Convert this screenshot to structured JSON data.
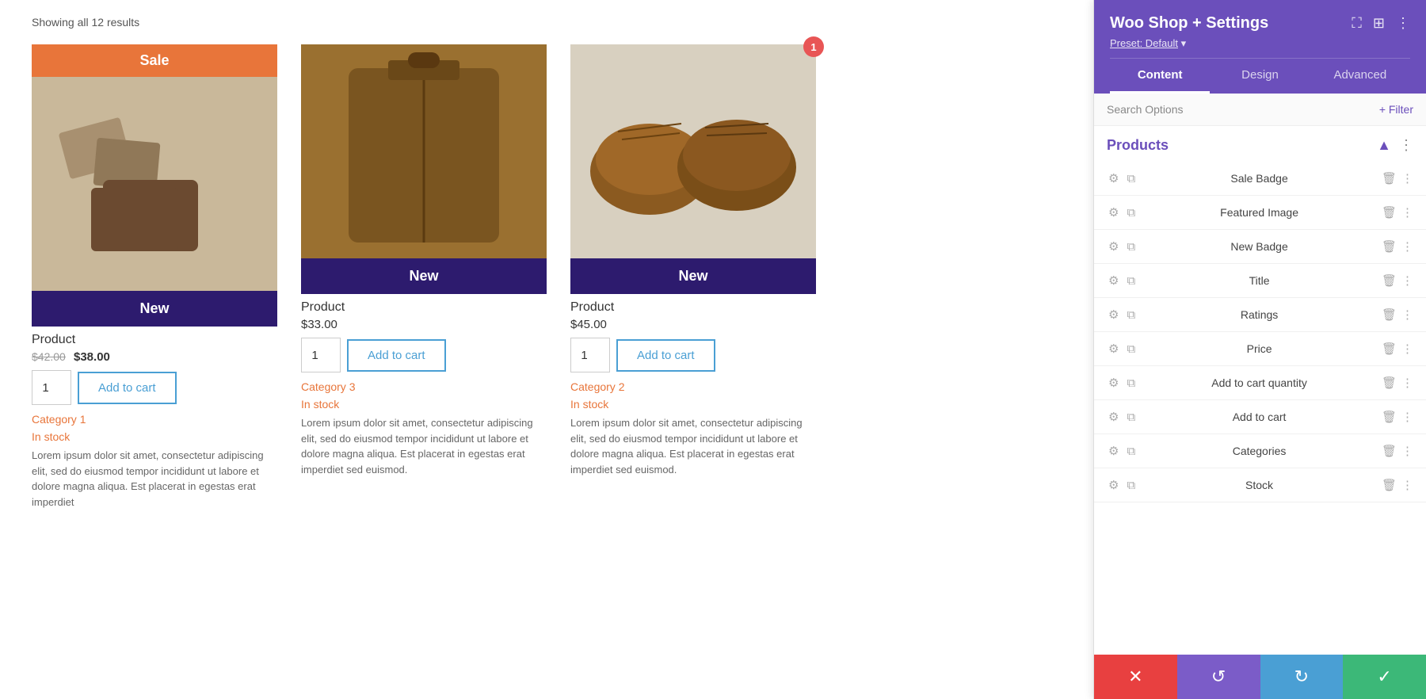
{
  "page": {
    "showing_results": "Showing all 12 results"
  },
  "products": [
    {
      "id": "product-1",
      "badge_sale": "Sale",
      "badge_new": "New",
      "has_sale_badge": true,
      "name": "Product",
      "price_old": "$42.00",
      "price_new": "$38.00",
      "qty": "1",
      "add_to_cart_label": "Add to cart",
      "category": "Category 1",
      "stock": "In stock",
      "description": "Lorem ipsum dolor sit amet, consectetur adipiscing elit, sed do eiusmod tempor incididunt ut labore et dolore magna aliqua. Est placerat in egestas erat imperdiet"
    },
    {
      "id": "product-2",
      "badge_new": "New",
      "has_sale_badge": false,
      "name": "Product",
      "price": "$33.00",
      "qty": "1",
      "add_to_cart_label": "Add to cart",
      "category": "Category 3",
      "stock": "In stock",
      "description": "Lorem ipsum dolor sit amet, consectetur adipiscing elit, sed do eiusmod tempor incididunt ut labore et dolore magna aliqua. Est placerat in egestas erat imperdiet sed euismod."
    },
    {
      "id": "product-3",
      "badge_new": "New",
      "has_sale_badge": false,
      "name": "Product",
      "price": "$45.00",
      "qty": "1",
      "add_to_cart_label": "Add to cart",
      "category": "Category 2",
      "stock": "In stock",
      "description": "Lorem ipsum dolor sit amet, consectetur adipiscing elit, sed do eiusmod tempor incididunt ut labore et dolore magna aliqua. Est placerat in egestas erat imperdiet sed euismod."
    }
  ],
  "panel": {
    "title": "Woo Shop + Settings",
    "preset_label": "Preset: Default",
    "tabs": [
      {
        "id": "content",
        "label": "Content",
        "active": true
      },
      {
        "id": "design",
        "label": "Design",
        "active": false
      },
      {
        "id": "advanced",
        "label": "Advanced",
        "active": false
      }
    ],
    "search_options_placeholder": "Search Options",
    "filter_label": "+ Filter",
    "sections": [
      {
        "id": "products",
        "title": "Products",
        "components": [
          {
            "id": "sale-badge",
            "name": "Sale Badge"
          },
          {
            "id": "featured-image",
            "name": "Featured Image"
          },
          {
            "id": "new-badge",
            "name": "New Badge"
          },
          {
            "id": "title",
            "name": "Title"
          },
          {
            "id": "ratings",
            "name": "Ratings"
          },
          {
            "id": "price",
            "name": "Price"
          },
          {
            "id": "add-to-cart-quantity",
            "name": "Add to cart quantity"
          },
          {
            "id": "add-to-cart",
            "name": "Add to cart"
          },
          {
            "id": "categories",
            "name": "Categories"
          },
          {
            "id": "stock",
            "name": "Stock"
          }
        ]
      }
    ]
  },
  "bottom_toolbar": {
    "close_label": "✕",
    "undo_label": "↺",
    "redo_label": "↻",
    "save_label": "✓"
  },
  "notification": {
    "badge_number": "1"
  }
}
